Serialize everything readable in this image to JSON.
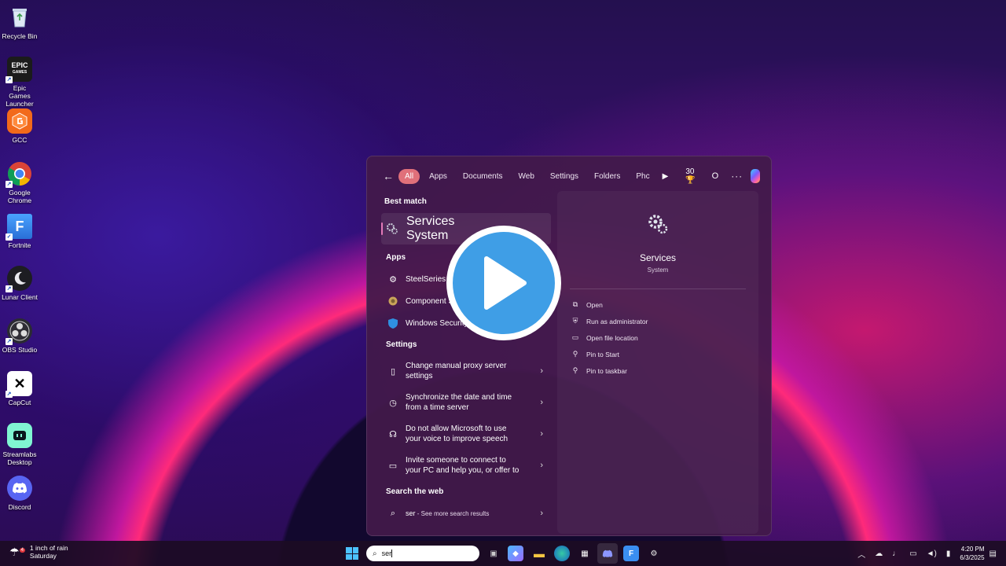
{
  "desktop": {
    "icons": [
      {
        "label": "Recycle Bin",
        "icon": "recycle-bin-icon"
      },
      {
        "label": "Epic Games Launcher",
        "icon": "epic-games-icon"
      },
      {
        "label": "GCC",
        "icon": "gcc-icon"
      },
      {
        "label": "Google Chrome",
        "icon": "chrome-icon"
      },
      {
        "label": "Fortnite",
        "icon": "fortnite-icon"
      },
      {
        "label": "Lunar Client",
        "icon": "lunar-client-icon"
      },
      {
        "label": "OBS Studio",
        "icon": "obs-icon"
      },
      {
        "label": "CapCut",
        "icon": "capcut-icon"
      },
      {
        "label": "Streamlabs Desktop",
        "icon": "streamlabs-icon"
      },
      {
        "label": "Discord",
        "icon": "discord-icon"
      }
    ]
  },
  "search_panel": {
    "filters": [
      "All",
      "Apps",
      "Documents",
      "Web",
      "Settings",
      "Folders",
      "Phc"
    ],
    "active_filter": "All",
    "points": "30",
    "profile_initial": "O",
    "best_match_heading": "Best match",
    "best_match": {
      "title": "Services",
      "subtitle": "System"
    },
    "apps_heading": "Apps",
    "apps": [
      {
        "title": "SteelSeries G"
      },
      {
        "title": "Component S"
      },
      {
        "title": "Windows Security"
      }
    ],
    "settings_heading": "Settings",
    "settings": [
      {
        "line1": "Change manual proxy server",
        "line2": "settings"
      },
      {
        "line1": "Synchronize the date and time",
        "line2": "from a time server"
      },
      {
        "line1": "Do not allow Microsoft to use",
        "line2": "your voice to improve speech"
      },
      {
        "line1": "Invite someone to connect to",
        "line2": "your PC and help you, or offer to"
      }
    ],
    "web_heading": "Search the web",
    "web_query": "ser",
    "web_suffix": " - See more search results",
    "detail": {
      "title": "Services",
      "subtitle": "System",
      "actions": [
        "Open",
        "Run as administrator",
        "Open file location",
        "Pin to Start",
        "Pin to taskbar"
      ]
    }
  },
  "taskbar": {
    "weather_line1": "1 inch of rain",
    "weather_line2": "Saturday",
    "weather_badge": "4",
    "search_value": "ser",
    "time": "4:20 PM",
    "date": "6/3/2025",
    "accent": "#4cc2ff"
  },
  "colors": {
    "active_chip": "#e0707a",
    "play_button": "#3f9ee6"
  }
}
